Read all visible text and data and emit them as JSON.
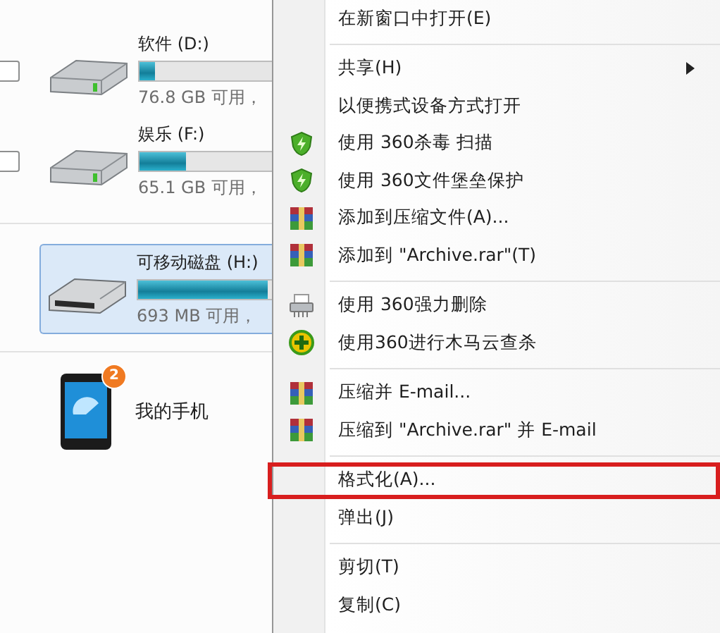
{
  "drives": [
    {
      "name": "软件 (D:)",
      "kind": "hdd",
      "level": 0.12,
      "free": "76.8 GB 可用，",
      "checked": false,
      "selected": false
    },
    {
      "name": "娱乐 (F:)",
      "kind": "hdd",
      "level": 0.35,
      "free": "65.1 GB 可用，",
      "checked": false,
      "selected": false
    },
    {
      "name": "可移动磁盘 (H:)",
      "kind": "removable",
      "level": 0.97,
      "free": "693 MB 可用，",
      "selected": true
    }
  ],
  "phone": {
    "name": "我的手机",
    "badge": "2"
  },
  "menu": [
    [
      {
        "label": "在新窗口中打开(E)",
        "kind": "plain",
        "submenu": false,
        "highlighted": false
      }
    ],
    [
      {
        "label": "共享(H)",
        "kind": "plain",
        "submenu": true,
        "highlighted": false
      },
      {
        "label": "以便携式设备方式打开",
        "kind": "plain",
        "submenu": false,
        "highlighted": false
      },
      {
        "label": "使用 360杀毒 扫描",
        "kind": "shield",
        "submenu": false,
        "highlighted": false
      },
      {
        "label": "使用 360文件堡垒保护",
        "kind": "shield",
        "submenu": false,
        "highlighted": false
      },
      {
        "label": "添加到压缩文件(A)...",
        "kind": "archive",
        "submenu": false,
        "highlighted": false
      },
      {
        "label": "添加到 \"Archive.rar\"(T)",
        "kind": "archive",
        "submenu": false,
        "highlighted": false
      }
    ],
    [
      {
        "label": "使用 360强力删除",
        "kind": "shredder",
        "submenu": false,
        "highlighted": false
      },
      {
        "label": "使用360进行木马云查杀",
        "kind": "scan",
        "submenu": false,
        "highlighted": false
      }
    ],
    [
      {
        "label": "压缩并 E-mail...",
        "kind": "archive",
        "submenu": false,
        "highlighted": false
      },
      {
        "label": "压缩到 \"Archive.rar\" 并 E-mail",
        "kind": "archive",
        "submenu": false,
        "highlighted": false
      }
    ],
    [
      {
        "label": "格式化(A)...",
        "kind": "plain",
        "submenu": false,
        "highlighted": true
      },
      {
        "label": "弹出(J)",
        "kind": "plain",
        "submenu": false,
        "highlighted": false
      }
    ],
    [
      {
        "label": "剪切(T)",
        "kind": "plain",
        "submenu": false,
        "highlighted": false
      },
      {
        "label": "复制(C)",
        "kind": "plain",
        "submenu": false,
        "highlighted": false
      }
    ]
  ]
}
